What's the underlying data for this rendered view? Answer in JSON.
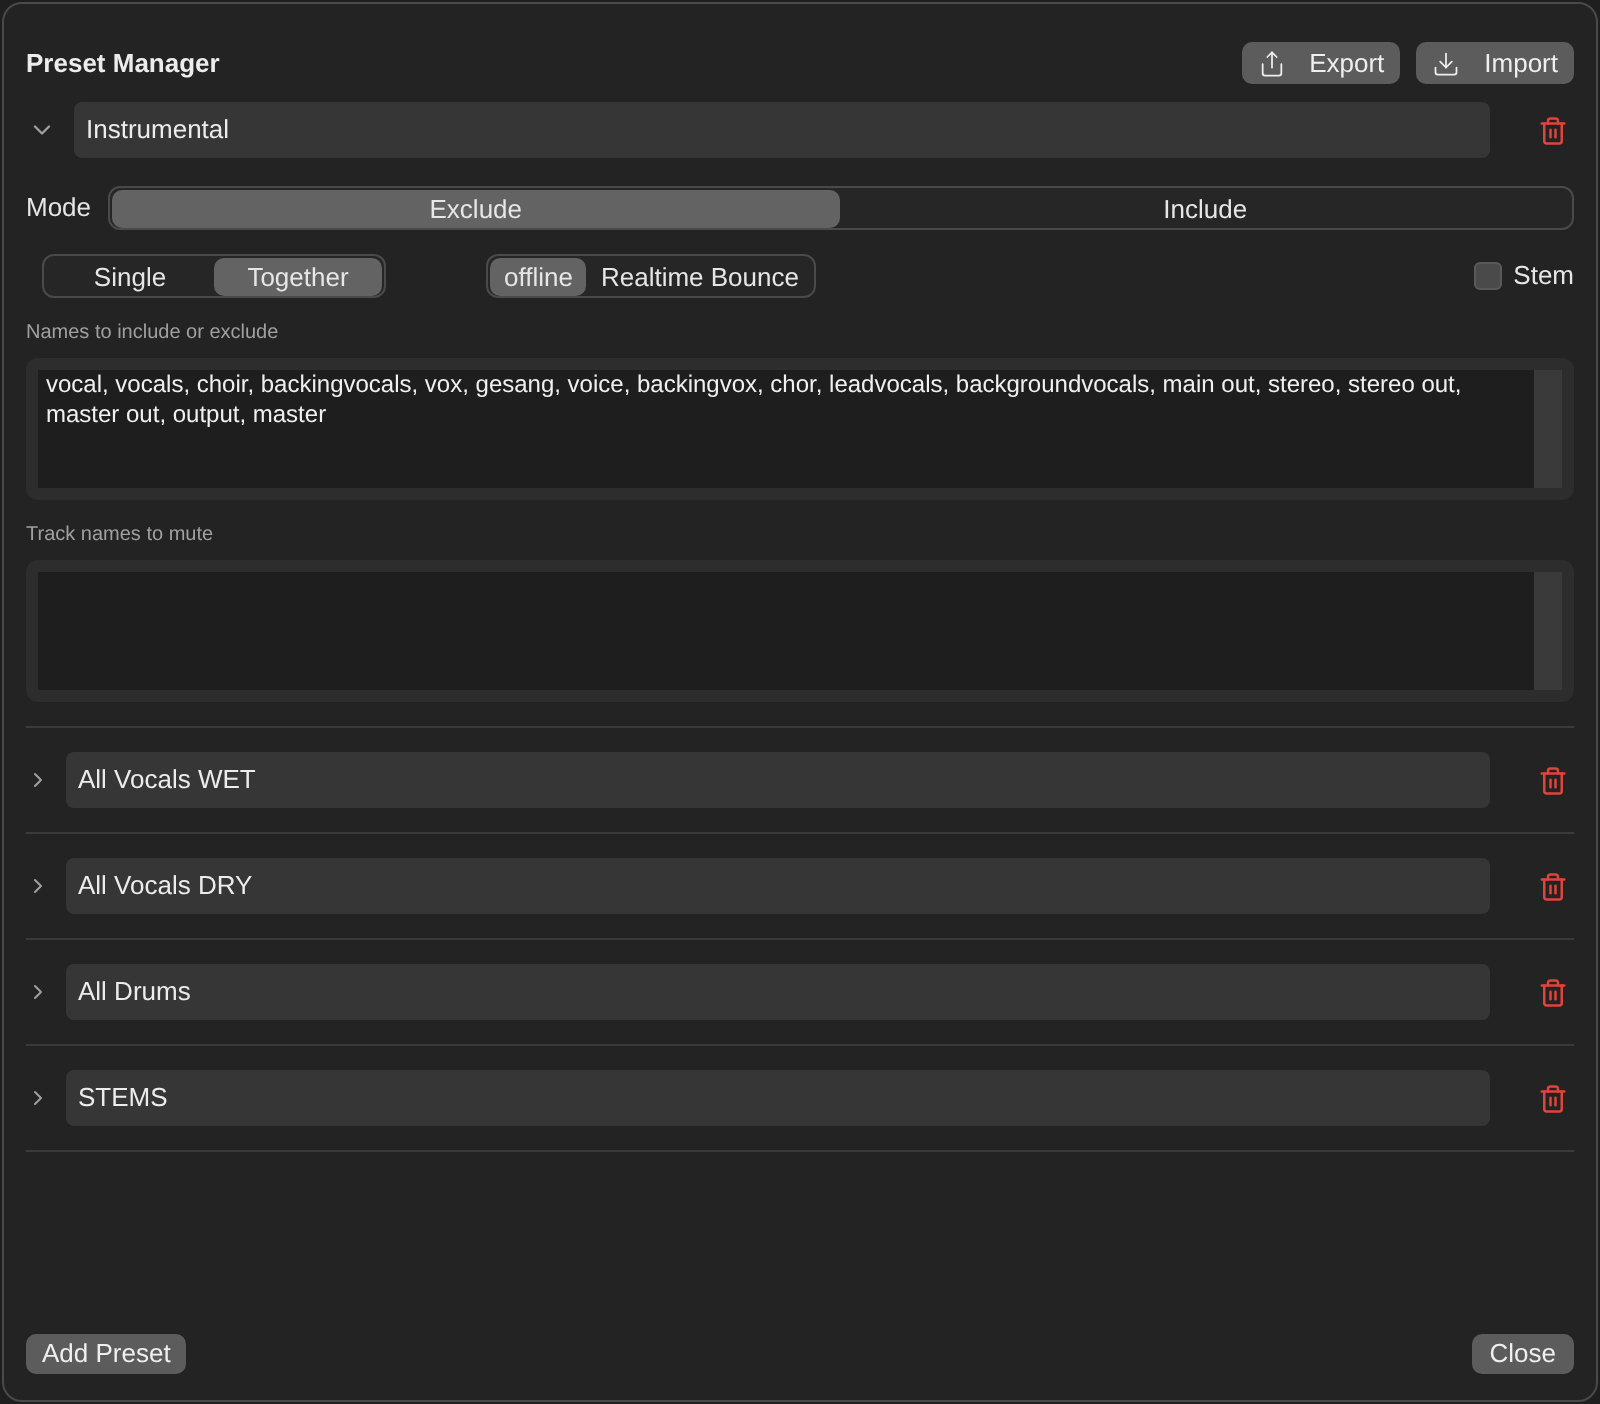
{
  "title": "Preset Manager",
  "header_buttons": [
    {
      "label": "Export",
      "kind": "export"
    },
    {
      "label": "Import",
      "kind": "import"
    }
  ],
  "presets": [
    {
      "name": "Instrumental",
      "expanded": true,
      "details": {
        "mode_label": "Mode",
        "mode": [
          {
            "label": "Exclude",
            "selected": true
          },
          {
            "label": "Include",
            "selected": false
          }
        ],
        "grouping": [
          {
            "label": "Single",
            "selected": false
          },
          {
            "label": "Together",
            "selected": true
          }
        ],
        "bounce": [
          {
            "label": "offline",
            "selected": true
          },
          {
            "label": "Realtime Bounce",
            "selected": false
          }
        ],
        "stem": {
          "label": "Stem",
          "checked": false
        },
        "fields": [
          {
            "label": "Names to include or exclude",
            "value": "vocal, vocals, choir, backingvocals, vox, gesang, voice, backingvox, chor, leadvocals, backgroundvocals, main out, stereo, stereo out, master out, output, master"
          },
          {
            "label": "Track names to mute"
          }
        ]
      }
    },
    {
      "name": "All Vocals WET",
      "expanded": false
    },
    {
      "name": "All Vocals DRY",
      "expanded": false
    },
    {
      "name": "All Drums",
      "expanded": false
    },
    {
      "name": "STEMS",
      "expanded": false
    }
  ],
  "footer": {
    "add": "Add Preset",
    "close": "Close"
  }
}
